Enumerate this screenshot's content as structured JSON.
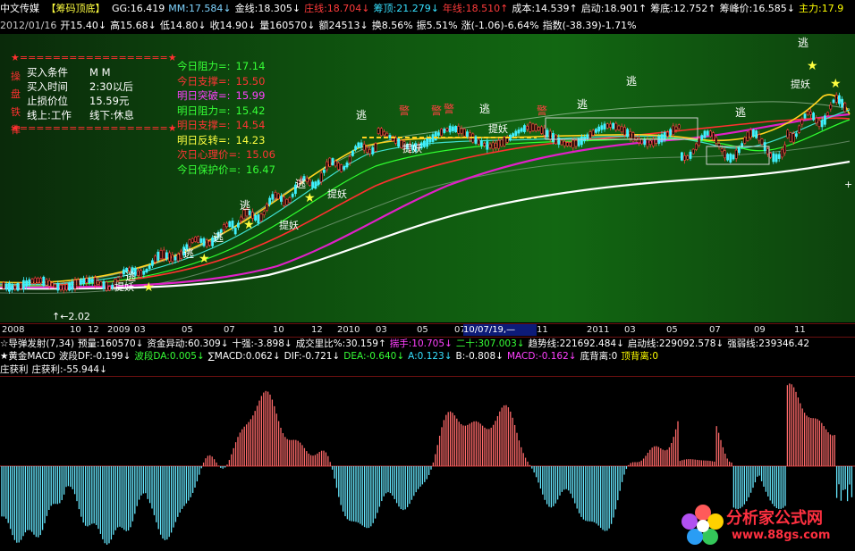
{
  "header": {
    "app_name": "中文传媒",
    "formula_tab": "【筹码顶底】",
    "items": [
      {
        "label": "GG:16.419",
        "color": "#ffffff"
      },
      {
        "label": "MM:17.584↓",
        "color": "#7fd4ff"
      },
      {
        "label": "金线:18.305↓",
        "color": "#ffffff"
      },
      {
        "label": "庄线:18.704↓",
        "color": "#ff3b3b"
      },
      {
        "label": "筹顶:21.279↓",
        "color": "#36e0ff"
      },
      {
        "label": "年线:18.510↑",
        "color": "#ff3b3b"
      },
      {
        "label": "成本:14.539↑",
        "color": "#ffffff"
      },
      {
        "label": "启动:18.901↑",
        "color": "#ffffff"
      },
      {
        "label": "筹底:12.752↑",
        "color": "#ffffff"
      },
      {
        "label": "筹峰价:16.585↓",
        "color": "#ffffff"
      },
      {
        "label": "主力:17.9",
        "color": "#ffff00"
      }
    ]
  },
  "quote_line": {
    "items": [
      {
        "label": "2012/01/16",
        "color": "#c8c8c8"
      },
      {
        "label": "开15.40↓",
        "color": "#ffffff"
      },
      {
        "label": "高15.68↓",
        "color": "#ffffff"
      },
      {
        "label": "低14.80↓",
        "color": "#ffffff"
      },
      {
        "label": "收14.90↓",
        "color": "#ffffff"
      },
      {
        "label": "量160570↓",
        "color": "#ffffff"
      },
      {
        "label": "额24513↓",
        "color": "#ffffff"
      },
      {
        "label": "换8.56%",
        "color": "#ffffff"
      },
      {
        "label": "振5.51%",
        "color": "#ffffff"
      },
      {
        "label": "涨(-1.06)-6.64%",
        "color": "#ffffff"
      },
      {
        "label": "指数(-38.39)-1.71%",
        "color": "#ffffff"
      }
    ]
  },
  "info_panel": {
    "separator": "★==================★",
    "side_chars": [
      "操",
      "盘",
      "铁",
      "律"
    ],
    "rows": [
      {
        "k": "买入条件",
        "v": "M M"
      },
      {
        "k": "买入时间",
        "v": "2:30以后"
      },
      {
        "k": "止损价位",
        "v": "15.59元"
      },
      {
        "k": "线上:工作",
        "v": "线下:休息"
      }
    ]
  },
  "levels": [
    {
      "label": "今日阻力=:",
      "value": "17.14",
      "color": "#36ff36"
    },
    {
      "label": "今日支撑=:",
      "value": "15.50",
      "color": "#ff3535"
    },
    {
      "label": "明日突破=:",
      "value": "15.99",
      "color": "#ff40ff"
    },
    {
      "label": "明日阻力=:",
      "value": "15.42",
      "color": "#36ff36"
    },
    {
      "label": "明日支撑=:",
      "value": "14.54",
      "color": "#ff3535"
    },
    {
      "label": "明日反转=:",
      "value": "14.23",
      "color": "#ffff40"
    },
    {
      "label": "次日心理价=:",
      "value": "15.06",
      "color": "#ff3535"
    },
    {
      "label": "今日保护价=:",
      "value": "16.47",
      "color": "#36ff36"
    }
  ],
  "chart": {
    "low_marker": "↑←2.02",
    "signals": [
      "逃",
      "逃",
      "逃",
      "逃",
      "逃",
      "逃",
      "警",
      "警",
      "警",
      "警",
      "逃",
      "逃",
      "逃",
      "逃",
      "逃"
    ],
    "labels": [
      "提妖",
      "提妖",
      "提妖",
      "提妖",
      "提妖",
      "提妖"
    ]
  },
  "date_axis": {
    "ticks": [
      "2008",
      "10",
      "12",
      "2009",
      "03",
      "05",
      "07",
      "10",
      "12",
      "2010",
      "03",
      "05",
      "07",
      "11",
      "2011",
      "03",
      "05",
      "07",
      "09",
      "11"
    ],
    "cursor": "10/07/19,—"
  },
  "indicators": {
    "line1": [
      {
        "label": "☆导弹发射(7,34)",
        "color": "#ffffff"
      },
      {
        "label": "预量:160570↓",
        "color": "#ffffff"
      },
      {
        "label": "资金异动:60.309↓",
        "color": "#ffffff"
      },
      {
        "label": "十强:-3.898↓",
        "color": "#ffffff"
      },
      {
        "label": "成交里比%:30.159↑",
        "color": "#ffffff"
      },
      {
        "label": "揣手:10.705↓",
        "color": "#ff40ff"
      },
      {
        "label": "二十:307.003↓",
        "color": "#36ff36"
      },
      {
        "label": "趋势线:221692.484↓",
        "color": "#ffffff"
      },
      {
        "label": "启动线:229092.578↓",
        "color": "#ffffff"
      },
      {
        "label": "强弱线:239346.42",
        "color": "#ffffff"
      }
    ],
    "line2": [
      {
        "label": "★黄金MACD",
        "color": "#ffffff"
      },
      {
        "label": "波段DF:-0.199↓",
        "color": "#ffffff"
      },
      {
        "label": "波段DA:0.005↓",
        "color": "#36ff36"
      },
      {
        "label": "∑MACD:0.062↓",
        "color": "#ffffff"
      },
      {
        "label": "DIF:-0.721↓",
        "color": "#ffffff"
      },
      {
        "label": "DEA:-0.640↓",
        "color": "#36ff36"
      },
      {
        "label": "A:0.123↓",
        "color": "#36e0ff"
      },
      {
        "label": "B:-0.808↓",
        "color": "#ffffff"
      },
      {
        "label": "MACD:-0.162↓",
        "color": "#ff40ff"
      },
      {
        "label": "底背离:0",
        "color": "#ffffff"
      },
      {
        "label": "顶背离:0",
        "color": "#ffff00"
      }
    ],
    "line3": [
      {
        "label": "庄获利",
        "color": "#ffffff"
      },
      {
        "label": "庄获利:-55.944↓",
        "color": "#ffffff"
      }
    ]
  },
  "watermark": {
    "brand": "分析家公式网",
    "url": "www.88gs.com"
  },
  "colors": {
    "up_bar": "#ff6a6a",
    "down_bar": "#66e8ff",
    "bg": "#000000"
  }
}
